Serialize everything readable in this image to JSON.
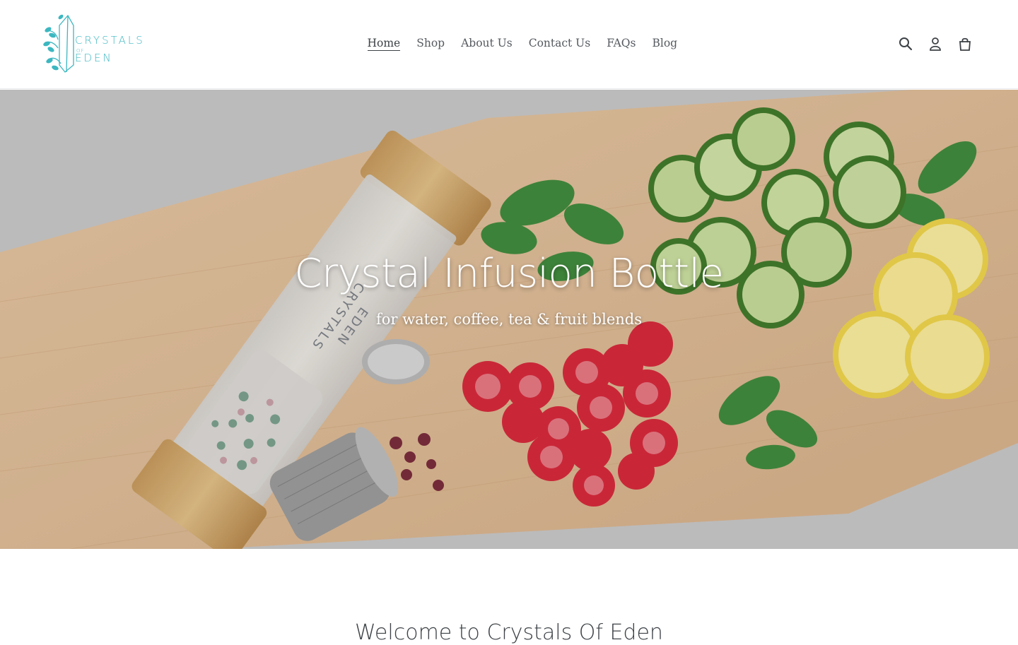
{
  "brand": {
    "line1": "CRYSTALS",
    "line2": "OF",
    "line3": "EDEN",
    "accent_color": "#3cb7c0"
  },
  "nav": {
    "items": [
      {
        "label": "Home",
        "active": true
      },
      {
        "label": "Shop"
      },
      {
        "label": "About Us"
      },
      {
        "label": "Contact Us"
      },
      {
        "label": "FAQs"
      },
      {
        "label": "Blog"
      }
    ]
  },
  "header_icons": [
    "search-icon",
    "account-icon",
    "cart-icon"
  ],
  "hero": {
    "title": "Crystal Infusion Bottle",
    "subtitle": "for water, coffee, tea & fruit blends",
    "bottle_print": {
      "line1": "CRYSTALS",
      "line2": "EDEN"
    }
  },
  "section": {
    "heading": "Welcome to Crystals Of Eden"
  }
}
